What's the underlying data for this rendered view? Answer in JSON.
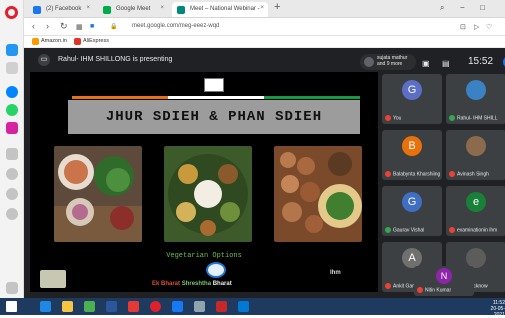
{
  "tabs": [
    {
      "label": "(2) Facebook",
      "color": "#1877f2"
    },
    {
      "label": "Google Meet",
      "color": "#00ac47"
    },
    {
      "label": "Meet – National Webinar -",
      "color": "#00897b"
    }
  ],
  "address": {
    "url": "meet.google.com/meg-eeez-wqd"
  },
  "bookmarks": [
    {
      "label": "Amazon.in",
      "color": "#ff9900"
    },
    {
      "label": "AliExpress",
      "color": "#e43225"
    }
  ],
  "meet": {
    "presenting_text": "Rahul- IHM SHILLONG is presenting",
    "pinned_text": [
      "sujata mathur",
      "and 9 more"
    ],
    "clock": "15:52",
    "user_initial": "G"
  },
  "slide": {
    "title": "JHUR SDIEH & PHAN SDIEH",
    "caption": "Vegetarian Options",
    "brand_prefix": "Ek Bharat",
    "brand_middle": "Shreshtha",
    "brand_suffix": "Bharat",
    "corner_mark": "Ihm"
  },
  "participants": [
    {
      "name": "You",
      "initial": "G",
      "color": "#5b6fc6"
    },
    {
      "name": "Rahul- IHM SHILL",
      "initial": "",
      "color": "#3b82c4"
    },
    {
      "name": "Balabynta Kharshiing",
      "initial": "B",
      "color": "#e8710a"
    },
    {
      "name": "Avinash Singh",
      "initial": "",
      "color": "#8c6a4e"
    },
    {
      "name": "Gaurav Vishal",
      "initial": "G",
      "color": "#3f6ec2"
    },
    {
      "name": "examinationin ihm",
      "initial": "e",
      "color": "#188038"
    },
    {
      "name": "Ankit Gambhare",
      "initial": "A",
      "color": "#707070"
    },
    {
      "name": "ihm_Lucknow",
      "initial": "",
      "color": "#5c5c5c"
    },
    {
      "name": "Nitin Kumar",
      "initial": "N",
      "color": "#8e24aa"
    }
  ],
  "taskbar": {
    "time": "11:52",
    "date": "20-05-2021"
  }
}
